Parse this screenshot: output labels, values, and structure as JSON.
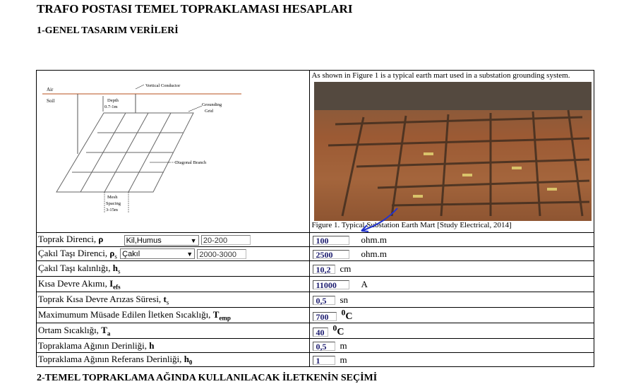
{
  "title": "TRAFO POSTASI TEMEL TOPRAKLAMASI HESAPLARI",
  "section1": "1-GENEL TASARIM VERİLERİ",
  "section2": "2-TEMEL TOPRAKLAMA AĞINDA KULLANILACAK  İLETKENİN SEÇİMİ",
  "diagram": {
    "air": "Air",
    "soil": "Soil",
    "depth": "Depth",
    "depth_val": "0.7-1m",
    "vertical": "Vertical Conductor",
    "grounding": "Grounding",
    "grid": "Grid",
    "diagonal": "Diagonal Branch",
    "mesh": "Mesh",
    "spacing": "Spacing",
    "spacing_val": "3-15m"
  },
  "photo_caption_top": "As shown in Figure 1 is a typical earth mart used in a substation grounding system.",
  "photo_caption_bottom": "Figure 1. Typical Substation Earth Mart [Study Electrical, 2014]",
  "rows": [
    {
      "label": "Toprak Direnci, ",
      "sym": "ρ",
      "sub": "",
      "select": "Kil,Humus",
      "range": "20-200",
      "value": "100",
      "unit": "ohm.m",
      "sup": ""
    },
    {
      "label": "Çakıl Taşı Direnci, ",
      "sym": "ρ",
      "sub": "s",
      "select": "Çakıl",
      "range": "2000-3000",
      "value": "2500",
      "unit": "ohm.m",
      "sup": ""
    },
    {
      "label": "Çakıl Taşı kalınlığı, ",
      "sym": "h",
      "sub": "s",
      "value": "10,2",
      "unit": "cm",
      "sup": ""
    },
    {
      "label": "Kısa Devre Akımı, ",
      "sym": "I",
      "sub": "efs",
      "value": "11000",
      "unit": "A",
      "sup": ""
    },
    {
      "label": "Toprak Kısa Devre Arızas Süresi, ",
      "sym": "t",
      "sub": "s",
      "value": "0,5",
      "unit": "sn",
      "sup": ""
    },
    {
      "label": "Maximumum Müsade Edilen İletken Sıcaklığı, ",
      "sym": "T",
      "sub": "emp",
      "value": "700",
      "unit": "C",
      "sup": "0"
    },
    {
      "label": "Ortam Sıcaklığı, ",
      "sym": "T",
      "sub": "a",
      "value": "40",
      "unit": "C",
      "sup": "0"
    },
    {
      "label": "Topraklama Ağının Derinliği, ",
      "sym": "h",
      "sub": "",
      "value": "0,5",
      "unit": "m",
      "sup": ""
    },
    {
      "label": "Topraklama Ağının Referans Derinliği, ",
      "sym": "h",
      "sub": "0",
      "value": "1",
      "unit": "m",
      "sup": ""
    }
  ]
}
